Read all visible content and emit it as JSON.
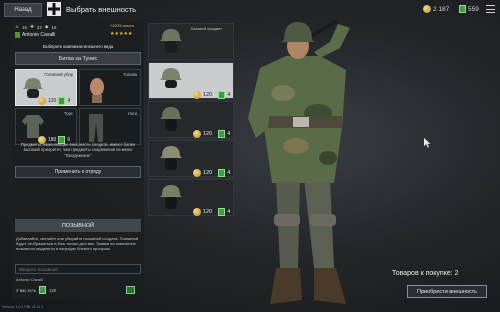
{
  "header": {
    "back_label": "Назад",
    "title": "Выбрать внешность",
    "gold": "2 187",
    "tickets": "559"
  },
  "soldier": {
    "rank": "16",
    "kills": "22",
    "level": "16",
    "exp_bonus": "+100% опыта",
    "name": "Antonio Cavalli",
    "stars": "★★★★★"
  },
  "campaign": {
    "prompt": "Выберите кампанию внешнего вида",
    "selected": "Битва за Тунис"
  },
  "slots": [
    {
      "label": "Головной убор",
      "price": "120",
      "tickets": "4"
    },
    {
      "label": "Голова"
    },
    {
      "label": "Торс",
      "price": "180",
      "tickets": "6"
    },
    {
      "label": "Ноги"
    }
  ],
  "warning": "Предметы, изменяющие внешность солдата, имеют более высокий приоритет, чем предметы снаряжения из меню \"Вооружение\"",
  "apply_label": "Применить к отряду",
  "callsign": {
    "header": "ПОЗЫВНОЙ",
    "description": "Добавляйте, меняйте или убирайте позывной солдата. Позывной будет отображаться в бою только для вас. Заявки на изменение позывного выдаются в наградах боевого пропуска.",
    "placeholder": "Введите позывной",
    "soldier_name": "Antonio Cavalli",
    "have_label": "У вас есть",
    "have_count": "120"
  },
  "items": [
    {
      "label": "Базовый предмет",
      "price": null,
      "tickets": null
    },
    {
      "label": "",
      "price": "120",
      "tickets": "4"
    },
    {
      "label": "",
      "price": "120",
      "tickets": "4"
    },
    {
      "label": "",
      "price": "120",
      "tickets": "4"
    },
    {
      "label": "",
      "price": "120",
      "tickets": "4"
    }
  ],
  "cart": {
    "goods_label": "Товаров к покупке: 2",
    "buy_label": "Приобрести внешность"
  },
  "version": "Version: 1.0.1 PBL 42.11.1"
}
